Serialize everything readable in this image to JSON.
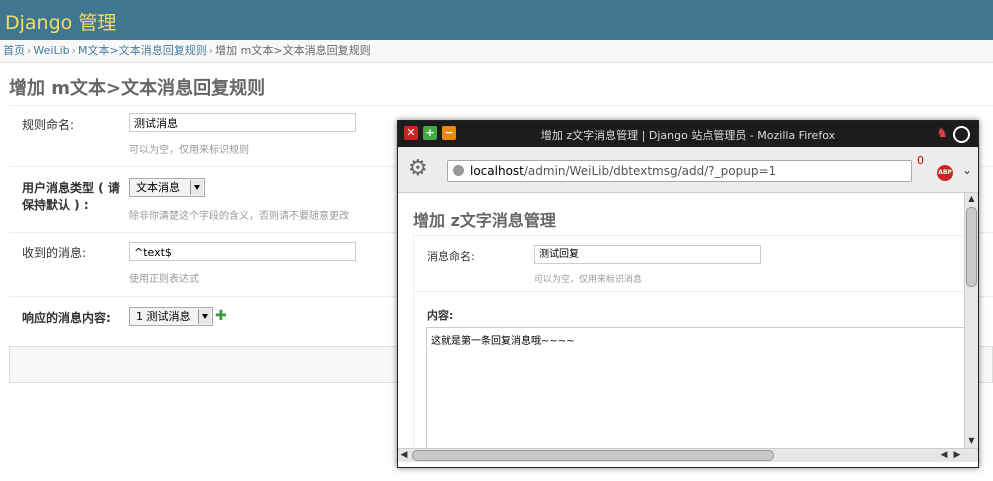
{
  "header": {
    "brand": "Django 管理"
  },
  "breadcrumbs": [
    {
      "label": "首页",
      "link": true
    },
    {
      "label": "WeiLib",
      "link": true
    },
    {
      "label": "M文本>文本消息回复规则",
      "link": true
    },
    {
      "label": "增加 m文本>文本消息回复规则",
      "link": false
    }
  ],
  "breadcrumb_sep": "›",
  "page_title": "增加 m文本>文本消息回复规则",
  "form": {
    "rule_name": {
      "label": "规则命名:",
      "value": "测试消息",
      "help": "可以为空，仅用来标识规则"
    },
    "msg_type": {
      "label_line1": "用户消息类型 ( 请",
      "label_line2": "保持默认 ) :",
      "value": "文本消息",
      "help": "除非你清楚这个字段的含义，否则请不要随意更改"
    },
    "received": {
      "label": "收到的消息:",
      "value": "^text$",
      "help": "使用正则表达式"
    },
    "response": {
      "label": "响应的消息内容:",
      "value": "1 测试消息",
      "add_icon": "add-icon"
    }
  },
  "popup": {
    "window_title": "增加 z文字消息管理 | Django 站点管理员 - Mozilla Firefox",
    "url_host": "localhost",
    "url_path": "/admin/WeiLib/dbtextmsg/add/?_popup=1",
    "download_count": "0",
    "abp_label": "ABP",
    "page_title": "增加 z文字消息管理",
    "name_field": {
      "label": "消息命名:",
      "value": "测试回复",
      "help": "可以为空，仅用来标识消息"
    },
    "content_field": {
      "label": "内容:",
      "value": "这就是第一条回复消息哦~~~~"
    }
  }
}
